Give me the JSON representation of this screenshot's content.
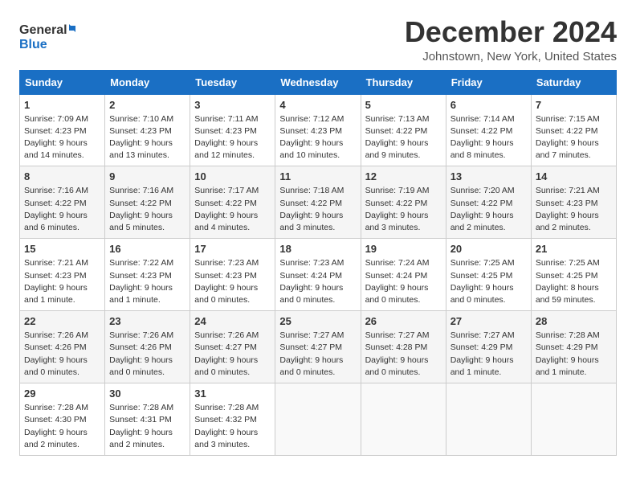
{
  "header": {
    "logo_line1": "General",
    "logo_line2": "Blue",
    "month": "December 2024",
    "location": "Johnstown, New York, United States"
  },
  "weekdays": [
    "Sunday",
    "Monday",
    "Tuesday",
    "Wednesday",
    "Thursday",
    "Friday",
    "Saturday"
  ],
  "weeks": [
    [
      {
        "day": "1",
        "sunrise": "Sunrise: 7:09 AM",
        "sunset": "Sunset: 4:23 PM",
        "daylight": "Daylight: 9 hours and 14 minutes."
      },
      {
        "day": "2",
        "sunrise": "Sunrise: 7:10 AM",
        "sunset": "Sunset: 4:23 PM",
        "daylight": "Daylight: 9 hours and 13 minutes."
      },
      {
        "day": "3",
        "sunrise": "Sunrise: 7:11 AM",
        "sunset": "Sunset: 4:23 PM",
        "daylight": "Daylight: 9 hours and 12 minutes."
      },
      {
        "day": "4",
        "sunrise": "Sunrise: 7:12 AM",
        "sunset": "Sunset: 4:23 PM",
        "daylight": "Daylight: 9 hours and 10 minutes."
      },
      {
        "day": "5",
        "sunrise": "Sunrise: 7:13 AM",
        "sunset": "Sunset: 4:22 PM",
        "daylight": "Daylight: 9 hours and 9 minutes."
      },
      {
        "day": "6",
        "sunrise": "Sunrise: 7:14 AM",
        "sunset": "Sunset: 4:22 PM",
        "daylight": "Daylight: 9 hours and 8 minutes."
      },
      {
        "day": "7",
        "sunrise": "Sunrise: 7:15 AM",
        "sunset": "Sunset: 4:22 PM",
        "daylight": "Daylight: 9 hours and 7 minutes."
      }
    ],
    [
      {
        "day": "8",
        "sunrise": "Sunrise: 7:16 AM",
        "sunset": "Sunset: 4:22 PM",
        "daylight": "Daylight: 9 hours and 6 minutes."
      },
      {
        "day": "9",
        "sunrise": "Sunrise: 7:16 AM",
        "sunset": "Sunset: 4:22 PM",
        "daylight": "Daylight: 9 hours and 5 minutes."
      },
      {
        "day": "10",
        "sunrise": "Sunrise: 7:17 AM",
        "sunset": "Sunset: 4:22 PM",
        "daylight": "Daylight: 9 hours and 4 minutes."
      },
      {
        "day": "11",
        "sunrise": "Sunrise: 7:18 AM",
        "sunset": "Sunset: 4:22 PM",
        "daylight": "Daylight: 9 hours and 3 minutes."
      },
      {
        "day": "12",
        "sunrise": "Sunrise: 7:19 AM",
        "sunset": "Sunset: 4:22 PM",
        "daylight": "Daylight: 9 hours and 3 minutes."
      },
      {
        "day": "13",
        "sunrise": "Sunrise: 7:20 AM",
        "sunset": "Sunset: 4:22 PM",
        "daylight": "Daylight: 9 hours and 2 minutes."
      },
      {
        "day": "14",
        "sunrise": "Sunrise: 7:21 AM",
        "sunset": "Sunset: 4:23 PM",
        "daylight": "Daylight: 9 hours and 2 minutes."
      }
    ],
    [
      {
        "day": "15",
        "sunrise": "Sunrise: 7:21 AM",
        "sunset": "Sunset: 4:23 PM",
        "daylight": "Daylight: 9 hours and 1 minute."
      },
      {
        "day": "16",
        "sunrise": "Sunrise: 7:22 AM",
        "sunset": "Sunset: 4:23 PM",
        "daylight": "Daylight: 9 hours and 1 minute."
      },
      {
        "day": "17",
        "sunrise": "Sunrise: 7:23 AM",
        "sunset": "Sunset: 4:23 PM",
        "daylight": "Daylight: 9 hours and 0 minutes."
      },
      {
        "day": "18",
        "sunrise": "Sunrise: 7:23 AM",
        "sunset": "Sunset: 4:24 PM",
        "daylight": "Daylight: 9 hours and 0 minutes."
      },
      {
        "day": "19",
        "sunrise": "Sunrise: 7:24 AM",
        "sunset": "Sunset: 4:24 PM",
        "daylight": "Daylight: 9 hours and 0 minutes."
      },
      {
        "day": "20",
        "sunrise": "Sunrise: 7:25 AM",
        "sunset": "Sunset: 4:25 PM",
        "daylight": "Daylight: 9 hours and 0 minutes."
      },
      {
        "day": "21",
        "sunrise": "Sunrise: 7:25 AM",
        "sunset": "Sunset: 4:25 PM",
        "daylight": "Daylight: 8 hours and 59 minutes."
      }
    ],
    [
      {
        "day": "22",
        "sunrise": "Sunrise: 7:26 AM",
        "sunset": "Sunset: 4:26 PM",
        "daylight": "Daylight: 9 hours and 0 minutes."
      },
      {
        "day": "23",
        "sunrise": "Sunrise: 7:26 AM",
        "sunset": "Sunset: 4:26 PM",
        "daylight": "Daylight: 9 hours and 0 minutes."
      },
      {
        "day": "24",
        "sunrise": "Sunrise: 7:26 AM",
        "sunset": "Sunset: 4:27 PM",
        "daylight": "Daylight: 9 hours and 0 minutes."
      },
      {
        "day": "25",
        "sunrise": "Sunrise: 7:27 AM",
        "sunset": "Sunset: 4:27 PM",
        "daylight": "Daylight: 9 hours and 0 minutes."
      },
      {
        "day": "26",
        "sunrise": "Sunrise: 7:27 AM",
        "sunset": "Sunset: 4:28 PM",
        "daylight": "Daylight: 9 hours and 0 minutes."
      },
      {
        "day": "27",
        "sunrise": "Sunrise: 7:27 AM",
        "sunset": "Sunset: 4:29 PM",
        "daylight": "Daylight: 9 hours and 1 minute."
      },
      {
        "day": "28",
        "sunrise": "Sunrise: 7:28 AM",
        "sunset": "Sunset: 4:29 PM",
        "daylight": "Daylight: 9 hours and 1 minute."
      }
    ],
    [
      {
        "day": "29",
        "sunrise": "Sunrise: 7:28 AM",
        "sunset": "Sunset: 4:30 PM",
        "daylight": "Daylight: 9 hours and 2 minutes."
      },
      {
        "day": "30",
        "sunrise": "Sunrise: 7:28 AM",
        "sunset": "Sunset: 4:31 PM",
        "daylight": "Daylight: 9 hours and 2 minutes."
      },
      {
        "day": "31",
        "sunrise": "Sunrise: 7:28 AM",
        "sunset": "Sunset: 4:32 PM",
        "daylight": "Daylight: 9 hours and 3 minutes."
      },
      null,
      null,
      null,
      null
    ]
  ]
}
